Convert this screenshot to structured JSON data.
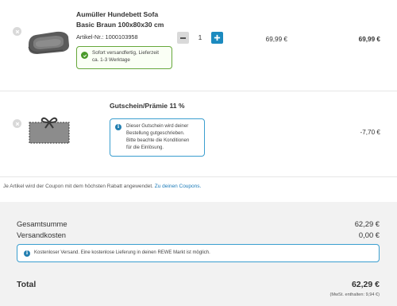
{
  "items": [
    {
      "title_line1": "Aumüller Hundebett Sofa",
      "title_line2": "Basic Braun 100x80x30 cm",
      "sku_label": "Artikel-Nr.: 1000103958",
      "quantity": "1",
      "unit_price": "69,99 €",
      "total_price": "69,99 €",
      "availability_line1": "Sofort versandfertig, Lieferzeit",
      "availability_line2": "ca. 1-3 Werktage"
    },
    {
      "title": "Gutschein/Prämie 11 %",
      "info_line1": "Dieser Gutschein wird deiner",
      "info_line2": "Bestellung gutgeschrieben.",
      "info_line3": "Bitte beachte die Konditionen",
      "info_line4": "für die Einlösung.",
      "discount": "-7,70 €"
    }
  ],
  "coupon_note": {
    "text": "Je Artikel wird der Coupon mit dem höchsten Rabatt angewendet.",
    "link": "Zu deinen Coupons."
  },
  "summary": {
    "subtotal_label": "Gesamtsumme",
    "subtotal_value": "62,29 €",
    "shipping_label": "Versandkosten",
    "shipping_value": "0,00 €",
    "shipping_notice": "Kostenloser Versand. Eine kostenlose Lieferung in deinen REWE Markt ist möglich.",
    "total_label": "Total",
    "total_value": "62,29 €",
    "vat_note": "(MwSt. enthalten: 9,94 €)"
  },
  "colors": {
    "accent_blue": "#1b8abf",
    "success_green": "#4a9a2a",
    "summary_bg": "#f2f2f2"
  }
}
